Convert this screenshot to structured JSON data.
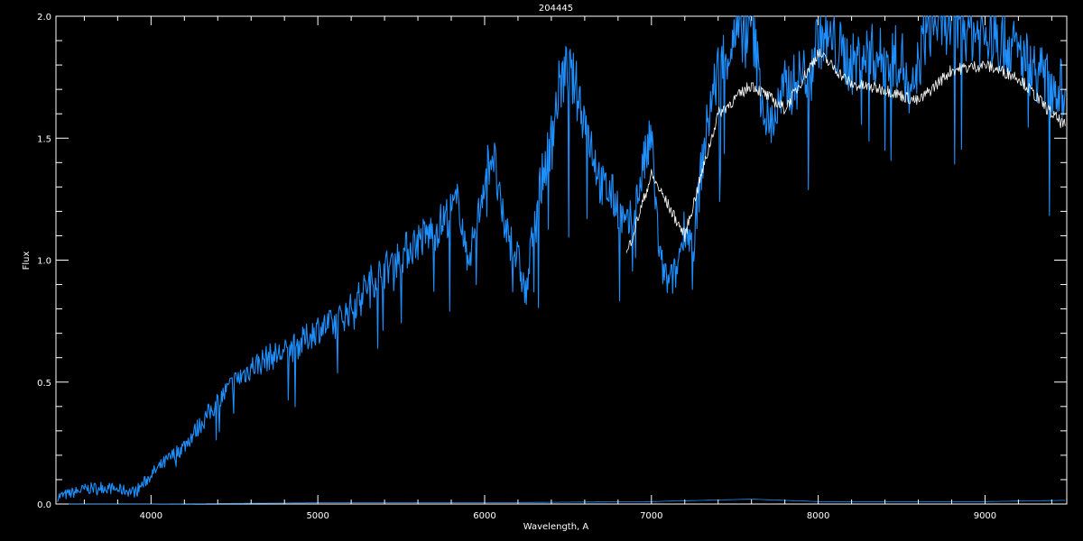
{
  "chart_data": {
    "type": "line",
    "title": "204445",
    "xlabel": "Wavelength, A",
    "ylabel": "Flux",
    "xlim": [
      3430,
      9490
    ],
    "ylim": [
      0.0,
      2.0
    ],
    "x_ticks": [
      4000,
      5000,
      6000,
      7000,
      8000,
      9000
    ],
    "x_tick_labels": [
      "4000",
      "5000",
      "6000",
      "7000",
      "8000",
      "9000"
    ],
    "y_ticks": [
      0.0,
      0.5,
      1.0,
      1.5,
      2.0
    ],
    "y_tick_labels": [
      "0.0",
      "0.5",
      "1.0",
      "1.5",
      "2.0"
    ],
    "grid": false,
    "colors": {
      "background": "#000000",
      "axes": "#ffffff",
      "spectrum": "#1e90ff",
      "model": "#ffffff"
    },
    "series": [
      {
        "color": "#1e90ff",
        "x": [
          3440,
          3500,
          3600,
          3700,
          3800,
          3900,
          3950,
          4000,
          4100,
          4200,
          4300,
          4400,
          4500,
          4600,
          4700,
          4800,
          4900,
          5000,
          5100,
          5200,
          5300,
          5400,
          5500,
          5600,
          5700,
          5800,
          5850,
          5890,
          5950,
          6000,
          6050,
          6100,
          6200,
          6250,
          6300,
          6400,
          6450,
          6500,
          6550,
          6600,
          6650,
          6700,
          6750,
          6800,
          6850,
          6900,
          6950,
          7000,
          7050,
          7100,
          7150,
          7200,
          7250,
          7300,
          7350,
          7400,
          7450,
          7500,
          7550,
          7600,
          7650,
          7700,
          7750,
          7800,
          7850,
          7900,
          7950,
          8000,
          8100,
          8200,
          8300,
          8400,
          8500,
          8550,
          8600,
          8650,
          8700,
          8800,
          8900,
          9000,
          9100,
          9200,
          9300,
          9400,
          9480
        ],
        "y": [
          0.03,
          0.04,
          0.06,
          0.07,
          0.06,
          0.05,
          0.08,
          0.12,
          0.18,
          0.24,
          0.33,
          0.42,
          0.5,
          0.56,
          0.6,
          0.62,
          0.66,
          0.72,
          0.74,
          0.8,
          0.9,
          0.96,
          1.02,
          1.08,
          1.12,
          1.2,
          1.24,
          1.0,
          1.12,
          1.35,
          1.45,
          1.18,
          1.0,
          0.85,
          1.2,
          1.5,
          1.72,
          1.78,
          1.7,
          1.58,
          1.45,
          1.3,
          1.28,
          1.22,
          1.12,
          1.2,
          1.38,
          1.5,
          1.0,
          0.9,
          0.95,
          1.15,
          1.05,
          1.38,
          1.62,
          1.78,
          1.85,
          1.9,
          1.95,
          1.98,
          1.72,
          1.55,
          1.6,
          1.7,
          1.72,
          1.76,
          1.78,
          1.92,
          1.88,
          1.8,
          1.85,
          1.82,
          1.84,
          1.62,
          1.8,
          1.95,
          1.98,
          1.98,
          1.95,
          1.92,
          1.9,
          1.85,
          1.78,
          1.72,
          1.7
        ]
      },
      {
        "color": "#ffffff",
        "x": [
          6850,
          7000,
          7200,
          7400,
          7600,
          7800,
          8000,
          8200,
          8400,
          8600,
          8800,
          9000,
          9200,
          9400,
          9480
        ],
        "y": [
          1.02,
          1.35,
          1.1,
          1.6,
          1.72,
          1.62,
          1.85,
          1.72,
          1.7,
          1.65,
          1.78,
          1.8,
          1.75,
          1.6,
          1.55
        ]
      },
      {
        "color": "#1e90ff",
        "x": [
          3440,
          4000,
          5000,
          6000,
          7000,
          7600,
          8000,
          9000,
          9480
        ],
        "y": [
          0.0,
          0.0,
          0.005,
          0.005,
          0.01,
          0.02,
          0.01,
          0.01,
          0.015
        ]
      }
    ]
  }
}
